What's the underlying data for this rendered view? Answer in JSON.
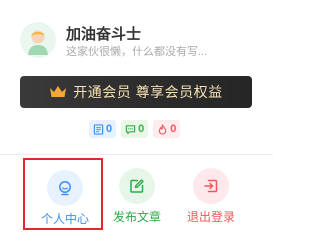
{
  "user": {
    "name": "加油奋斗士",
    "bio": "这家伙很懒，什么都没有写..."
  },
  "vip": {
    "label": "开通会员 尊享会员权益"
  },
  "stats": {
    "articles": "0",
    "comments": "0",
    "likes": "0"
  },
  "actions": [
    {
      "label": "个人中心",
      "icon": "user-icon"
    },
    {
      "label": "发布文章",
      "icon": "edit-icon"
    },
    {
      "label": "退出登录",
      "icon": "logout-icon"
    }
  ],
  "colors": {
    "blue": "#3f8ff0",
    "green": "#2ea84a",
    "red": "#f0565b",
    "gold": "#f6e0b8",
    "highlight": "#e5262b"
  }
}
